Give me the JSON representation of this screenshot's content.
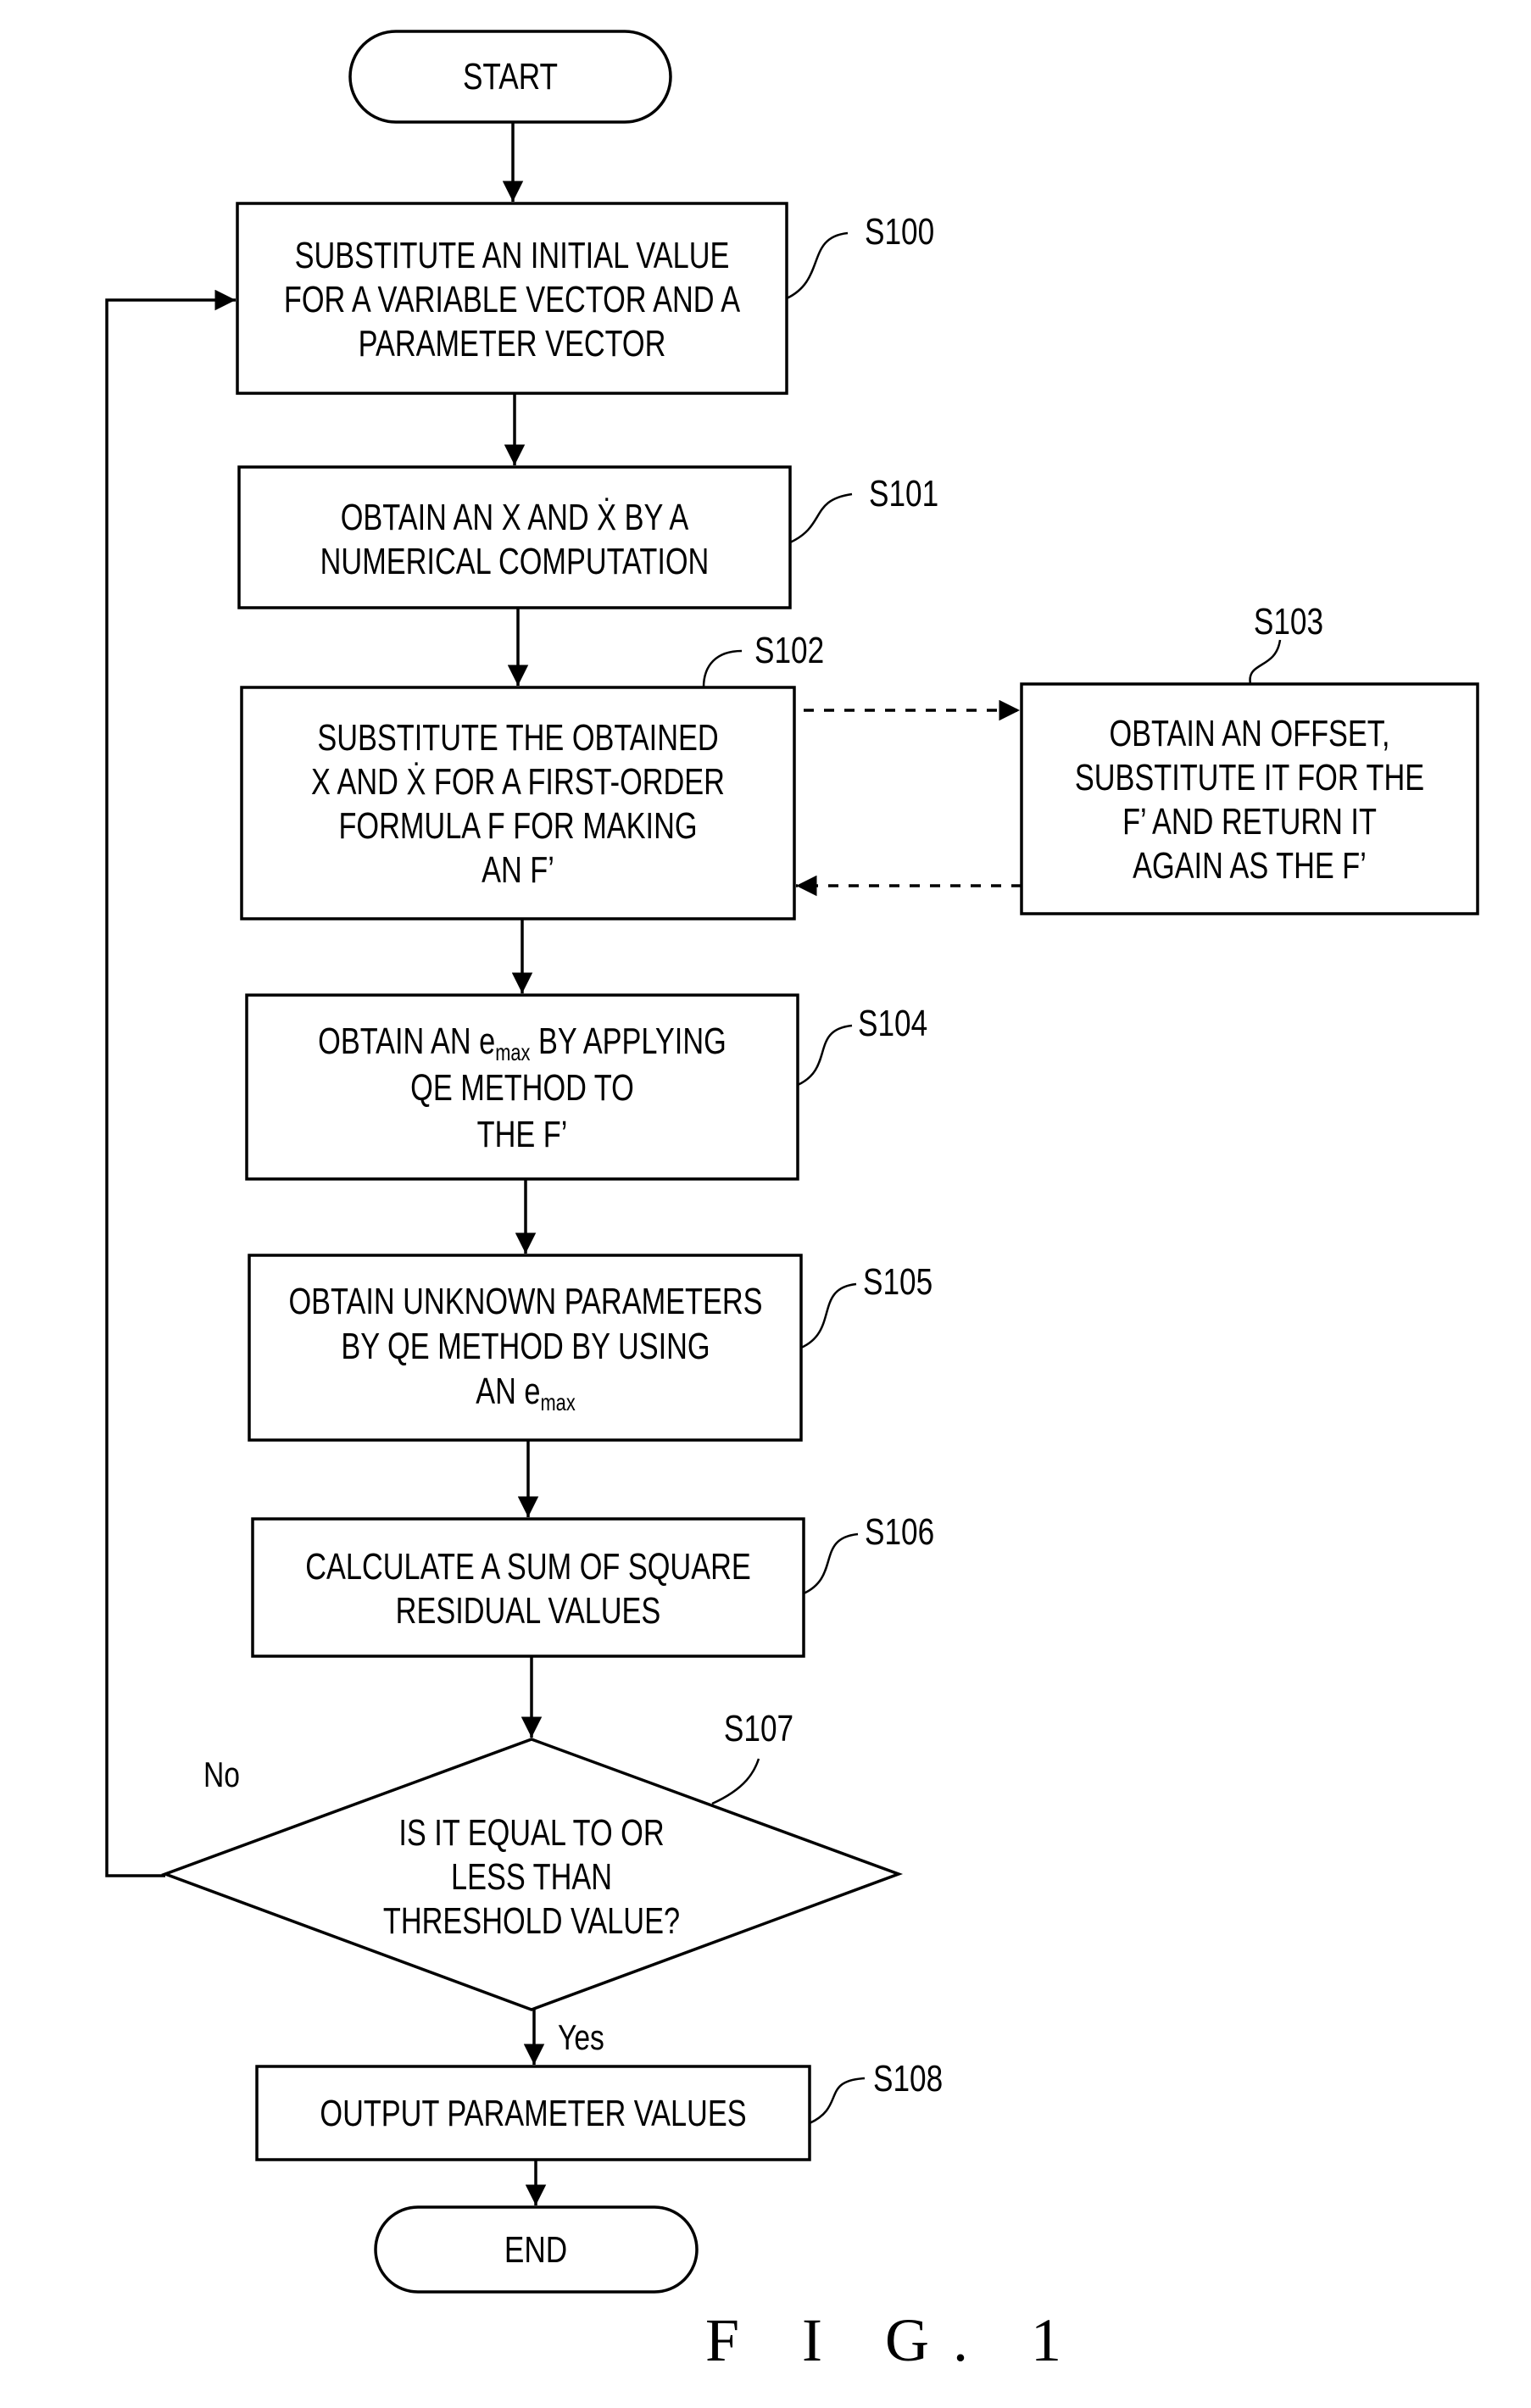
{
  "figure": {
    "caption": "F I G.  1"
  },
  "terminals": {
    "start": "START",
    "end": "END"
  },
  "steps": [
    {
      "id": "S100",
      "lines": [
        "SUBSTITUTE AN INITIAL VALUE",
        "FOR A VARIABLE VECTOR AND A",
        "PARAMETER VECTOR"
      ]
    },
    {
      "id": "S101",
      "lines": [
        "OBTAIN AN X AND Ẋ BY A",
        "NUMERICAL COMPUTATION"
      ]
    },
    {
      "id": "S102",
      "lines": [
        "SUBSTITUTE THE OBTAINED",
        "X AND Ẋ FOR A FIRST-ORDER",
        "FORMULA F FOR MAKING",
        "AN F’"
      ]
    },
    {
      "id": "S103",
      "lines": [
        "OBTAIN AN OFFSET,",
        "SUBSTITUTE IT FOR THE",
        "F’  AND RETURN IT",
        "AGAIN AS THE F’"
      ]
    },
    {
      "id": "S104",
      "lines": [
        "OBTAIN AN e|max| BY APPLYING",
        "QE METHOD TO",
        "THE F’"
      ]
    },
    {
      "id": "S105",
      "lines": [
        "OBTAIN UNKNOWN PARAMETERS",
        "BY QE METHOD BY USING",
        "AN e|max|"
      ]
    },
    {
      "id": "S106",
      "lines": [
        "CALCULATE A SUM OF SQUARE",
        "RESIDUAL VALUES"
      ]
    },
    {
      "id": "S107",
      "lines": [
        "IS IT EQUAL TO OR",
        "LESS THAN",
        "THRESHOLD VALUE?"
      ]
    },
    {
      "id": "S108",
      "lines": [
        "OUTPUT PARAMETER VALUES"
      ]
    }
  ],
  "branches": {
    "no": "No",
    "yes": "Yes"
  }
}
